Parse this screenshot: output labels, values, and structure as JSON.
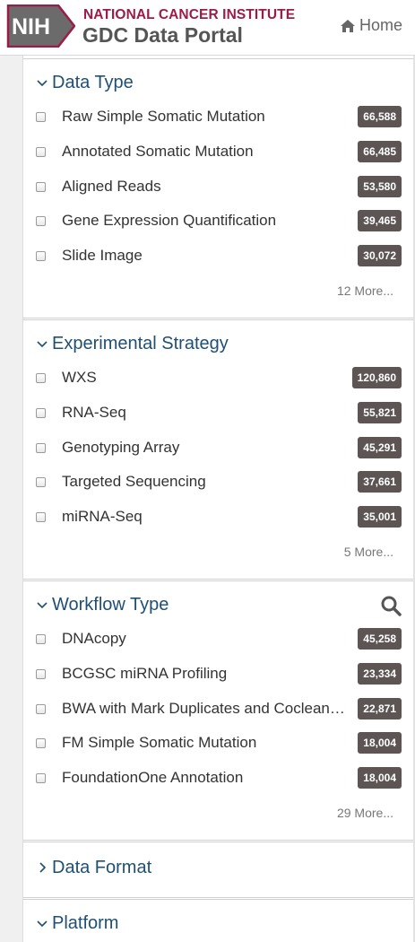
{
  "header": {
    "logo_text": "NIH",
    "institute": "NATIONAL CANCER INSTITUTE",
    "portal": "GDC Data Portal",
    "home_label": "Home"
  },
  "facets": [
    {
      "title": "Data Type",
      "expanded": true,
      "items": [
        {
          "label": "Raw Simple Somatic Mutation",
          "count": "66,588"
        },
        {
          "label": "Annotated Somatic Mutation",
          "count": "66,485"
        },
        {
          "label": "Aligned Reads",
          "count": "53,580"
        },
        {
          "label": "Gene Expression Quantification",
          "count": "39,465"
        },
        {
          "label": "Slide Image",
          "count": "30,072"
        }
      ],
      "more": "12 More..."
    },
    {
      "title": "Experimental Strategy",
      "expanded": true,
      "items": [
        {
          "label": "WXS",
          "count": "120,860"
        },
        {
          "label": "RNA-Seq",
          "count": "55,821"
        },
        {
          "label": "Genotyping Array",
          "count": "45,291"
        },
        {
          "label": "Targeted Sequencing",
          "count": "37,661"
        },
        {
          "label": "miRNA-Seq",
          "count": "35,001"
        }
      ],
      "more": "5 More..."
    },
    {
      "title": "Workflow Type",
      "expanded": true,
      "items": [
        {
          "label": "DNAcopy",
          "count": "45,258"
        },
        {
          "label": "BCGSC miRNA Profiling",
          "count": "23,334"
        },
        {
          "label": "BWA with Mark Duplicates and Cocleaning",
          "count": "22,871"
        },
        {
          "label": "FM Simple Somatic Mutation",
          "count": "18,004"
        },
        {
          "label": "FoundationOne Annotation",
          "count": "18,004"
        }
      ],
      "more": "29 More..."
    },
    {
      "title": "Data Format",
      "expanded": false
    },
    {
      "title": "Platform",
      "expanded": true
    }
  ],
  "colors": {
    "brand": "#9c1c48",
    "facet_title": "#1f4f75",
    "badge_bg": "#5d5454"
  }
}
